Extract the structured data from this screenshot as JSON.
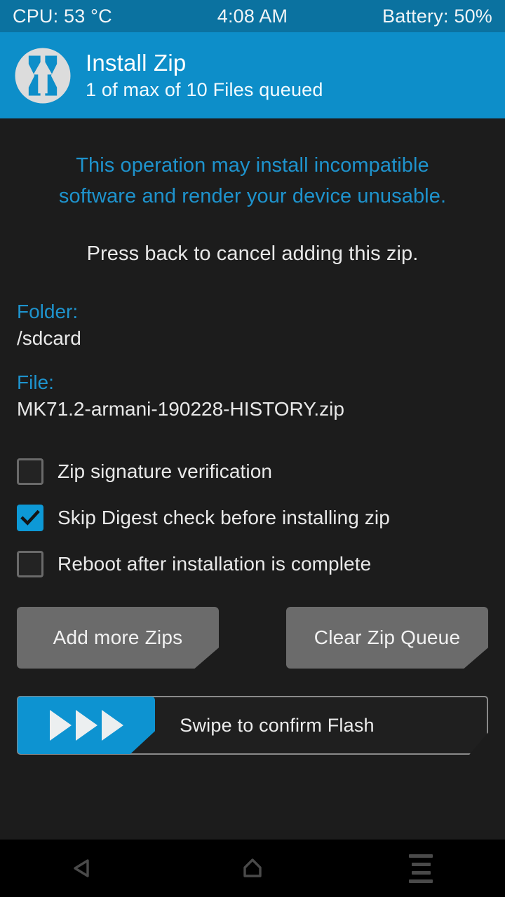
{
  "statusbar": {
    "cpu": "CPU: 53 °C",
    "time": "4:08 AM",
    "battery": "Battery: 50%"
  },
  "header": {
    "logo_icon": "twrp-logo-icon",
    "title": "Install Zip",
    "subtitle": "1 of max of 10 Files queued"
  },
  "main": {
    "warning_line1": "This operation may install incompatible",
    "warning_line2": "software and render your device unusable.",
    "notice": "Press back to cancel adding this zip.",
    "folder_label": "Folder:",
    "folder_value": "/sdcard",
    "file_label": "File:",
    "file_value": "MK71.2-armani-190228-HISTORY.zip",
    "checkboxes": [
      {
        "label": "Zip signature verification",
        "checked": false
      },
      {
        "label": "Skip Digest check before installing zip",
        "checked": true
      },
      {
        "label": "Reboot after installation is complete",
        "checked": false
      }
    ],
    "buttons": {
      "add_more": "Add more Zips",
      "clear_queue": "Clear Zip Queue"
    },
    "swipe": {
      "text": "Swipe to confirm Flash",
      "handle_icon": "triple-play-arrow-icon"
    }
  },
  "navbar": {
    "back_icon": "back-triangle-icon",
    "home_icon": "home-icon",
    "menu_icon": "menu-lines-icon"
  },
  "colors": {
    "statusbar_bg": "#0b72a0",
    "header_bg": "#0d8ec9",
    "accent_blue": "#1e93cd",
    "checkbox_on": "#0d99d6",
    "button_gray": "#6b6b6b",
    "content_bg": "#1c1c1c",
    "navbar_bg": "#000000"
  }
}
